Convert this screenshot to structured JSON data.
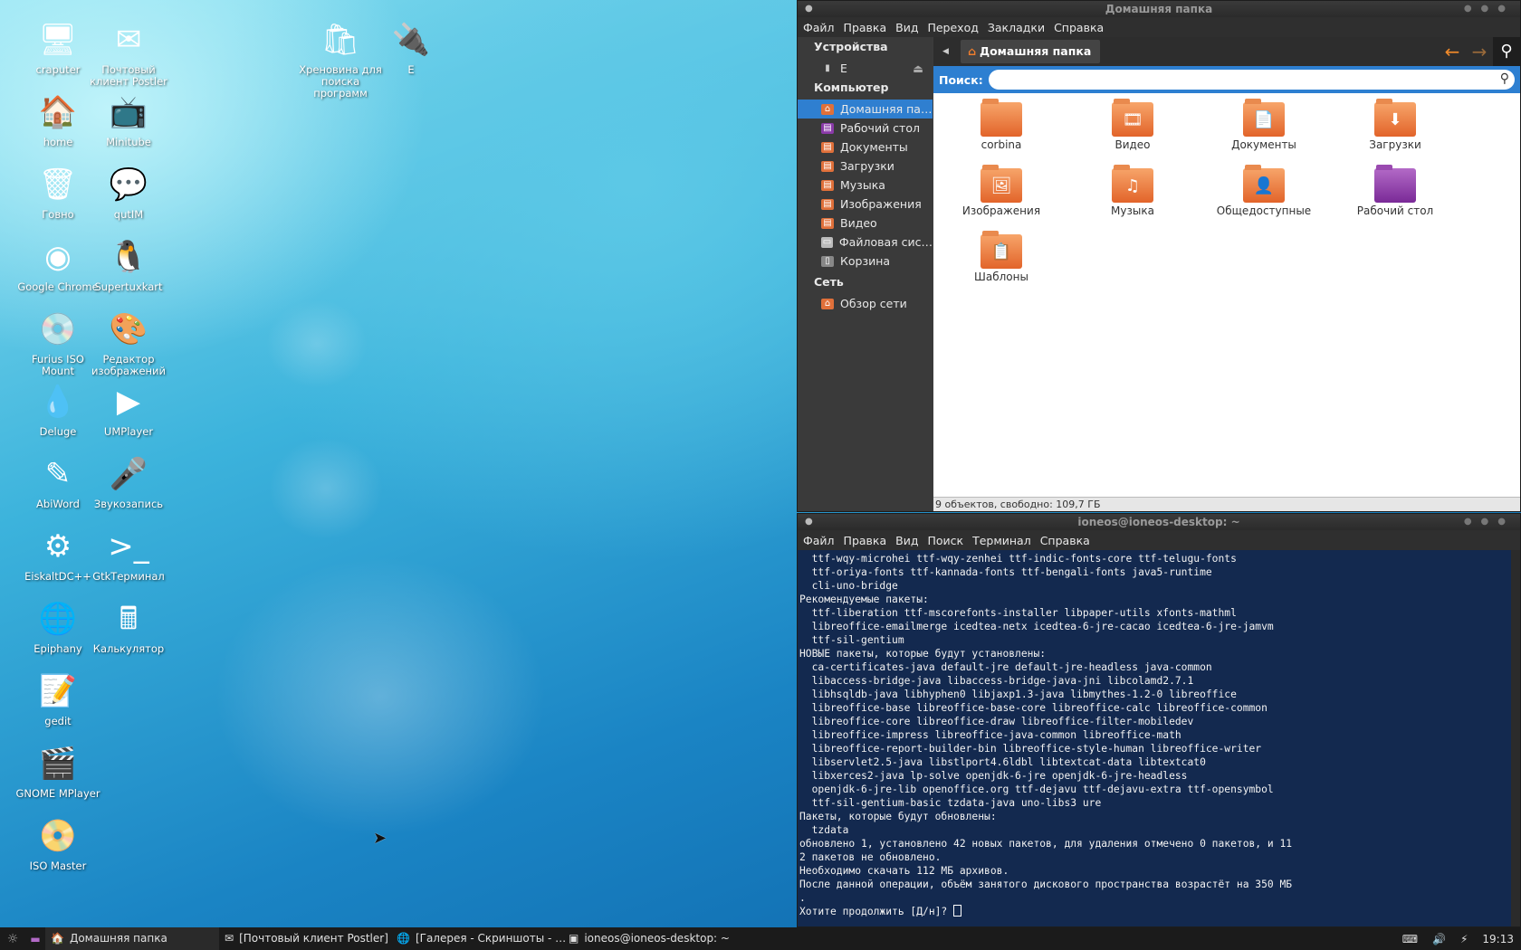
{
  "desktop": {
    "icons": [
      {
        "label": "craputer",
        "glyph": "🖥"
      },
      {
        "label": "Почтовый клиент Postler",
        "glyph": "✉"
      },
      {
        "label": "Хреновина для поиска программ",
        "glyph": "🛍"
      },
      {
        "label": "E",
        "glyph": "🔌"
      },
      {
        "label": "home",
        "glyph": "🏠"
      },
      {
        "label": "Minitube",
        "glyph": "📺"
      },
      {
        "label": "Говно",
        "glyph": "🗑"
      },
      {
        "label": "qutIM",
        "glyph": "💬"
      },
      {
        "label": "Google Chrome",
        "glyph": "◉"
      },
      {
        "label": "Supertuxkart",
        "glyph": "🐧"
      },
      {
        "label": "Furius ISO Mount",
        "glyph": "💿"
      },
      {
        "label": "Редактор изображений",
        "glyph": "🎨"
      },
      {
        "label": "Deluge",
        "glyph": "💧"
      },
      {
        "label": "UMPlayer",
        "glyph": "▶"
      },
      {
        "label": "AbiWord",
        "glyph": "✎"
      },
      {
        "label": "Звукозапись",
        "glyph": "🎤"
      },
      {
        "label": "EiskaltDC++",
        "glyph": "⚙"
      },
      {
        "label": "GtkТерминал",
        "glyph": ">_"
      },
      {
        "label": "Epiphany",
        "glyph": "🌐"
      },
      {
        "label": "Калькулятор",
        "glyph": "🖩"
      },
      {
        "label": "gedit",
        "glyph": "📝"
      },
      {
        "label": "GNOME MPlayer",
        "glyph": "🎬"
      },
      {
        "label": "ISO Master",
        "glyph": "📀"
      }
    ]
  },
  "file_manager": {
    "title": "Домашняя папка",
    "menu": [
      "Файл",
      "Правка",
      "Вид",
      "Переход",
      "Закладки",
      "Справка"
    ],
    "sidebar": {
      "devices_heading": "Устройства",
      "devices": [
        {
          "label": "E"
        }
      ],
      "computer_heading": "Компьютер",
      "computer": [
        {
          "label": "Домашняя па…",
          "icon": "home-icon"
        },
        {
          "label": "Рабочий стол",
          "icon": "desktop-icon"
        },
        {
          "label": "Документы",
          "icon": "documents-icon"
        },
        {
          "label": "Загрузки",
          "icon": "downloads-icon"
        },
        {
          "label": "Музыка",
          "icon": "music-icon"
        },
        {
          "label": "Изображения",
          "icon": "pictures-icon"
        },
        {
          "label": "Видео",
          "icon": "video-icon"
        },
        {
          "label": "Файловая сис…",
          "icon": "filesystem-icon"
        },
        {
          "label": "Корзина",
          "icon": "trash-icon"
        }
      ],
      "network_heading": "Сеть",
      "network": [
        {
          "label": "Обзор сети",
          "icon": "network-icon"
        }
      ]
    },
    "breadcrumb": "Домашняя папка",
    "search_label": "Поиск:",
    "search_value": "",
    "items": [
      {
        "label": "corbina",
        "glyph": "",
        "style": "orange"
      },
      {
        "label": "Видео",
        "glyph": "🎞",
        "style": "orange"
      },
      {
        "label": "Документы",
        "glyph": "📄",
        "style": "orange"
      },
      {
        "label": "Загрузки",
        "glyph": "⬇",
        "style": "orange"
      },
      {
        "label": "Изображения",
        "glyph": "🖼",
        "style": "orange"
      },
      {
        "label": "Музыка",
        "glyph": "♫",
        "style": "orange"
      },
      {
        "label": "Общедоступные",
        "glyph": "👤",
        "style": "orange"
      },
      {
        "label": "Рабочий стол",
        "glyph": "",
        "style": "purple"
      },
      {
        "label": "Шаблоны",
        "glyph": "📋",
        "style": "orange"
      }
    ],
    "status": "9 объектов, свободно: 109,7 ГБ"
  },
  "terminal": {
    "title": "ioneos@ioneos-desktop: ~",
    "menu": [
      "Файл",
      "Правка",
      "Вид",
      "Поиск",
      "Терминал",
      "Справка"
    ],
    "lines": [
      "  ttf-wqy-microhei ttf-wqy-zenhei ttf-indic-fonts-core ttf-telugu-fonts",
      "  ttf-oriya-fonts ttf-kannada-fonts ttf-bengali-fonts java5-runtime",
      "  cli-uno-bridge",
      "Рекомендуемые пакеты:",
      "  ttf-liberation ttf-mscorefonts-installer libpaper-utils xfonts-mathml",
      "  libreoffice-emailmerge icedtea-netx icedtea-6-jre-cacao icedtea-6-jre-jamvm",
      "  ttf-sil-gentium",
      "НОВЫЕ пакеты, которые будут установлены:",
      "  ca-certificates-java default-jre default-jre-headless java-common",
      "  libaccess-bridge-java libaccess-bridge-java-jni libcolamd2.7.1",
      "  libhsqldb-java libhyphen0 libjaxp1.3-java libmythes-1.2-0 libreoffice",
      "  libreoffice-base libreoffice-base-core libreoffice-calc libreoffice-common",
      "  libreoffice-core libreoffice-draw libreoffice-filter-mobiledev",
      "  libreoffice-impress libreoffice-java-common libreoffice-math",
      "  libreoffice-report-builder-bin libreoffice-style-human libreoffice-writer",
      "  libservlet2.5-java libstlport4.6ldbl libtextcat-data libtextcat0",
      "  libxerces2-java lp-solve openjdk-6-jre openjdk-6-jre-headless",
      "  openjdk-6-jre-lib openoffice.org ttf-dejavu ttf-dejavu-extra ttf-opensymbol",
      "  ttf-sil-gentium-basic tzdata-java uno-libs3 ure",
      "Пакеты, которые будут обновлены:",
      "  tzdata",
      "обновлено 1, установлено 42 новых пакетов, для удаления отмечено 0 пакетов, и 11",
      "2 пакетов не обновлено.",
      "Необходимо скачать 112 МБ архивов.",
      "После данной операции, объём занятого дискового пространства возрастёт на 350 МБ",
      "."
    ],
    "prompt": "Хотите продолжить [Д/н]? "
  },
  "taskbar": {
    "items": [
      {
        "label": "Домашняя папка",
        "glyph": "🏠"
      },
      {
        "label": "[Почтовый клиент Postler]",
        "glyph": "✉"
      },
      {
        "label": "[Галерея - Скриншоты - …",
        "glyph": "🌐"
      },
      {
        "label": "ioneos@ioneos-desktop: ~",
        "glyph": "▣"
      }
    ],
    "clock": "19:13"
  }
}
